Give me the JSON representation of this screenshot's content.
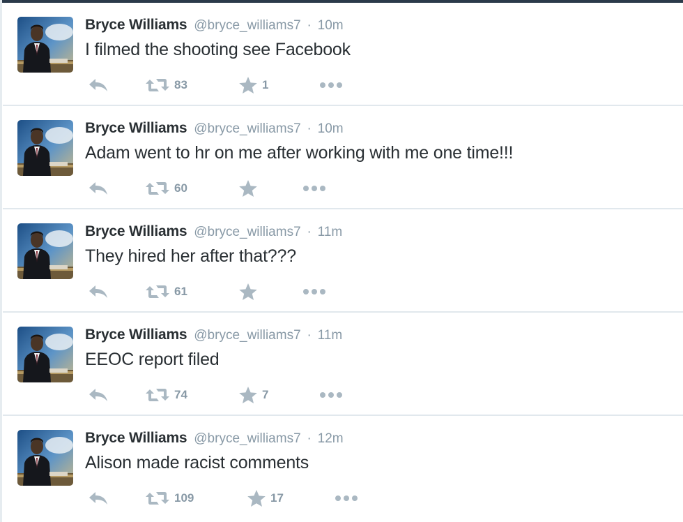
{
  "colors": {
    "name": "#292f33",
    "meta": "#8899a6",
    "icon": "#aab8c2",
    "divider": "#e1e8ed"
  },
  "icons": {
    "reply": "reply-icon",
    "retweet": "retweet-icon",
    "favorite": "star-icon",
    "more": "more-dots-icon"
  },
  "tweets": [
    {
      "name": "Bryce Williams",
      "handle": "@bryce_williams7",
      "separator": "·",
      "time": "10m",
      "text": "I filmed the shooting see Facebook",
      "retweets": "83",
      "favorites": "1"
    },
    {
      "name": "Bryce Williams",
      "handle": "@bryce_williams7",
      "separator": "·",
      "time": "10m",
      "text": "Adam went to hr on me after working with me one time!!!",
      "retweets": "60",
      "favorites": ""
    },
    {
      "name": "Bryce Williams",
      "handle": "@bryce_williams7",
      "separator": "·",
      "time": "11m",
      "text": "They hired her after that???",
      "retweets": "61",
      "favorites": ""
    },
    {
      "name": "Bryce Williams",
      "handle": "@bryce_williams7",
      "separator": "·",
      "time": "11m",
      "text": "EEOC report filed",
      "retweets": "74",
      "favorites": "7"
    },
    {
      "name": "Bryce Williams",
      "handle": "@bryce_williams7",
      "separator": "·",
      "time": "12m",
      "text": "Alison made racist comments",
      "retweets": "109",
      "favorites": "17"
    }
  ]
}
